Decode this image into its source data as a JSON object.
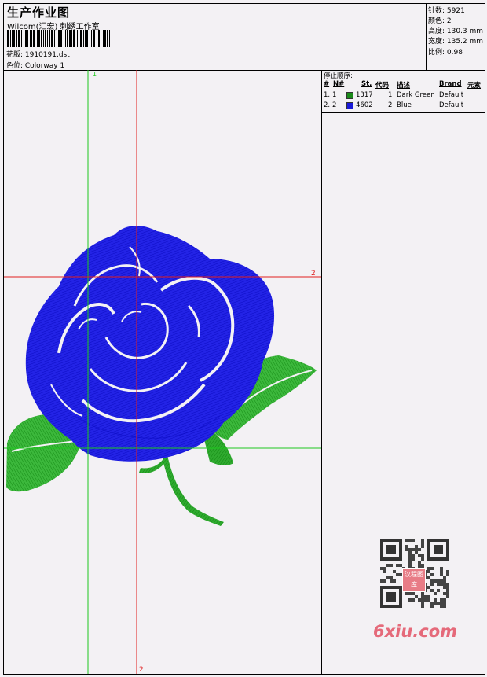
{
  "header": {
    "title": "生产作业图",
    "studio": "Wilcom(汇宏) 刺绣工作室",
    "pattern_file": "花版: 1910191.dst",
    "colorway": "色位: Colorway 1"
  },
  "stats": {
    "stitches": "针数: 5921",
    "colors": "颜色: 2",
    "height": "高度: 130.3 mm",
    "width": "宽度: 135.2 mm",
    "scale": "比例: 0.98"
  },
  "stop_sequence": {
    "caption": "停止顺序:",
    "headers": [
      "#",
      "N#",
      "St.",
      "代码",
      "描述",
      "Brand",
      "元素"
    ],
    "rows": [
      {
        "idx": "1.",
        "n": "1",
        "swatch": "#1a8a1a",
        "stitches": "1317",
        "code": "1",
        "desc": "Dark Green",
        "brand": "Default"
      },
      {
        "idx": "2.",
        "n": "2",
        "swatch": "#1a1ad8",
        "stitches": "4602",
        "code": "2",
        "desc": "Blue",
        "brand": "Default"
      }
    ]
  },
  "guides": {
    "vertical_green_label": "1",
    "horizontal_red_label": "2",
    "vertical_red_label": "2",
    "colors": {
      "green": "#1ec81e",
      "red": "#e01e1e"
    }
  },
  "watermark": {
    "site": "6xiu.com",
    "stamp": "汉程图库"
  },
  "colors": {
    "rose": "#1a1ae0",
    "leaf": "#22a022",
    "accent": "#e56a7a"
  }
}
